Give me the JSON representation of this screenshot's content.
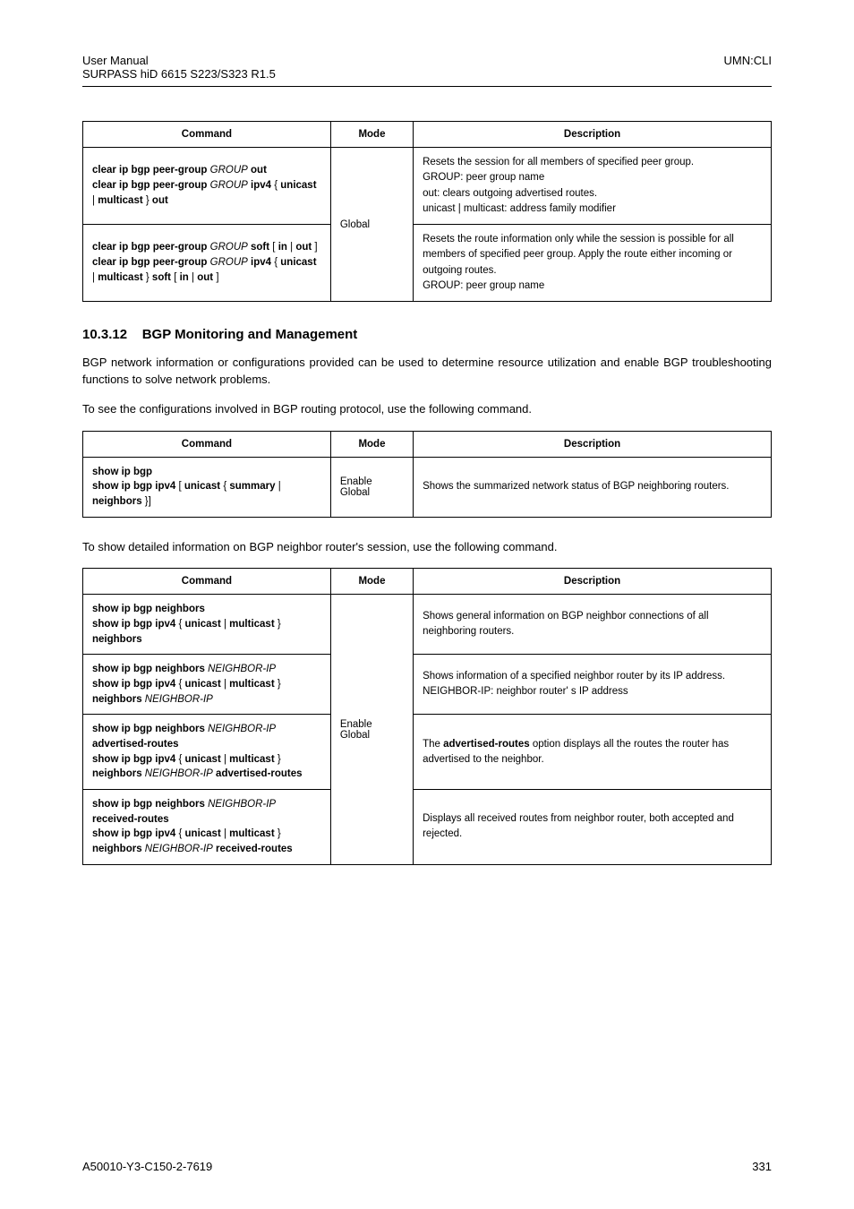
{
  "header": {
    "left_line1": "User Manual",
    "left_line2": "SURPASS hiD 6615 S223/S323 R1.5",
    "right": "UMN:CLI"
  },
  "table1": {
    "headers": [
      "Command",
      "Mode",
      "Description"
    ],
    "mode": "Global",
    "rows": [
      {
        "cmd_html": "<span class='cmd-strong'>clear ip bgp peer-group</span> <i>GROUP</i> <span class='cmd-strong'>out</span><br><span class='cmd-strong'>clear ip bgp peer-group</span> <i>GROUP</i> <span class='cmd-strong'>ipv4</span> { <span class='cmd-strong'>unicast</span> | <span class='cmd-strong'>multicast</span> } <span class='cmd-strong'>out</span>",
        "desc": "Resets the session for all members of specified peer group.<br>GROUP: peer group name<br>out: clears outgoing advertised routes.<br>unicast | multicast: address family modifier"
      },
      {
        "cmd_html": "<span class='cmd-strong'>clear ip bgp peer-group</span> <i>GROUP</i> <span class='cmd-strong'>soft</span> [ <span class='cmd-strong'>in</span> | <span class='cmd-strong'>out</span> ]<br><span class='cmd-strong'>clear ip bgp peer-group</span> <i>GROUP</i> <span class='cmd-strong'>ipv4</span> { <span class='cmd-strong'>unicast</span> | <span class='cmd-strong'>multicast</span> } <span class='cmd-strong'>soft</span> [ <span class='cmd-strong'>in</span> | <span class='cmd-strong'>out</span> ]",
        "desc": "Resets the route information only while the session is possible for all members of specified peer group. Apply the route either incoming or outgoing routes.<br>GROUP: peer group name"
      }
    ]
  },
  "section": {
    "number": "10.3.12",
    "title": "BGP Monitoring and Management",
    "para1": "BGP network information or configurations provided can be used to determine resource utilization and enable BGP troubleshooting functions to solve network problems.",
    "para2": "To see the configurations involved in BGP routing protocol, use the following command."
  },
  "table2": {
    "headers": [
      "Command",
      "Mode",
      "Description"
    ],
    "row": {
      "cmd_html": "<span class='cmd-strong'>show ip bgp</span><br><span class='cmd-strong'>show ip bgp ipv4</span> [ <span class='cmd-strong'>unicast</span> { <span class='cmd-strong'>summary</span> | <span class='cmd-strong'>neighbors</span> }]",
      "mode": "Enable<br>Global",
      "desc": "Shows the summarized network status of BGP neighboring routers."
    }
  },
  "between_para": "To show detailed information on BGP neighbor router's session, use the following command.",
  "table3": {
    "headers": [
      "Command",
      "Mode",
      "Description"
    ],
    "mode": "Enable<br>Global",
    "rows": [
      {
        "cmd_html": "<span class='cmd-strong'>show ip bgp neighbors</span><br><span class='cmd-strong'>show ip bgp ipv4</span> { <span class='cmd-strong'>unicast</span> | <span class='cmd-strong'>multicast</span> } <span class='cmd-strong'>neighbors</span>",
        "desc": "Shows general information on BGP neighbor connections of all neighboring routers."
      },
      {
        "cmd_html": "<span class='cmd-strong'>show ip bgp neighbors</span> <i>NEIGHBOR-IP</i><br><span class='cmd-strong'>show ip bgp ipv4</span> { <span class='cmd-strong'>unicast</span> | <span class='cmd-strong'>multicast</span> } <span class='cmd-strong'>neighbors</span> <i>NEIGHBOR-IP</i>",
        "desc": "Shows information of a specified neighbor router by its IP address.<br>NEIGHBOR-IP: neighbor router' s IP address"
      },
      {
        "cmd_html": "<span class='cmd-strong'>show ip bgp neighbors</span> <i>NEIGHBOR-IP</i> <span class='cmd-strong'>advertised-routes</span><br><span class='cmd-strong'>show ip bgp ipv4</span> { <span class='cmd-strong'>unicast</span> | <span class='cmd-strong'>multicast</span> } <span class='cmd-strong'>neighbors</span> <i>NEIGHBOR-IP</i> <span class='cmd-strong'>advertised-routes</span>",
        "desc": "The <span class='cmd-strong'>advertised-routes</span> option displays all the routes the router has advertised to the neighbor."
      },
      {
        "cmd_html": "<span class='cmd-strong'>show ip bgp neighbors</span> <i>NEIGHBOR-IP</i> <span class='cmd-strong'>received-routes</span><br><span class='cmd-strong'>show ip bgp ipv4</span> { <span class='cmd-strong'>unicast</span> | <span class='cmd-strong'>multicast</span> } <span class='cmd-strong'>neighbors</span> <i>NEIGHBOR-IP</i> <span class='cmd-strong'>received-routes</span>",
        "desc": "Displays all received routes from neighbor router, both accepted and rejected."
      }
    ]
  },
  "footer": {
    "left": "A50010-Y3-C150-2-7619",
    "right": "331"
  }
}
